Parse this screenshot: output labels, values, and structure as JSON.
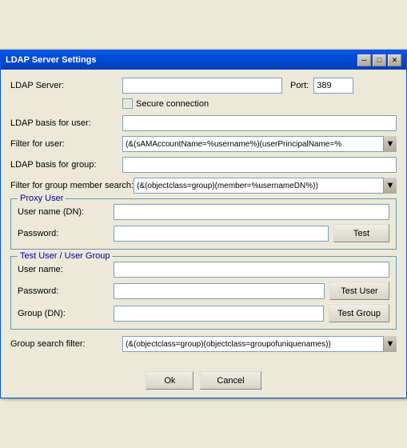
{
  "window": {
    "title": "LDAP Server Settings",
    "close_btn": "✕",
    "minimize_btn": "─",
    "maximize_btn": "□"
  },
  "form": {
    "ldap_server_label": "LDAP Server:",
    "ldap_server_value": "",
    "port_label": "Port:",
    "port_value": "389",
    "secure_label": "Secure connection",
    "ldap_basis_user_label": "LDAP basis for user:",
    "ldap_basis_user_value": "",
    "filter_user_label": "Filter for user:",
    "filter_user_value": "(&(sAMAccountName=%username%)(userPrincipalName=%",
    "ldap_basis_group_label": "LDAP basis for group:",
    "ldap_basis_group_value": "",
    "filter_group_label": "Filter for group member search:",
    "filter_group_value": "(&(objectclass=group)(member=%usernameDN%))"
  },
  "proxy_user": {
    "section_title": "Proxy User",
    "username_label": "User name (DN):",
    "username_value": "",
    "password_label": "Password:",
    "password_value": "",
    "test_btn": "Test"
  },
  "test_section": {
    "section_title": "Test User / User Group",
    "username_label": "User name:",
    "username_value": "",
    "password_label": "Password:",
    "password_value": "",
    "group_label": "Group (DN):",
    "group_value": "",
    "test_user_btn": "Test User",
    "test_group_btn": "Test Group"
  },
  "footer": {
    "group_search_label": "Group search filter:",
    "group_search_value": "(&(objectclass=group)(objectclass=groupofuniquenames))",
    "ok_btn": "Ok",
    "cancel_btn": "Cancel"
  },
  "icons": {
    "dropdown_arrow": "▼",
    "checkbox_checked": ""
  }
}
